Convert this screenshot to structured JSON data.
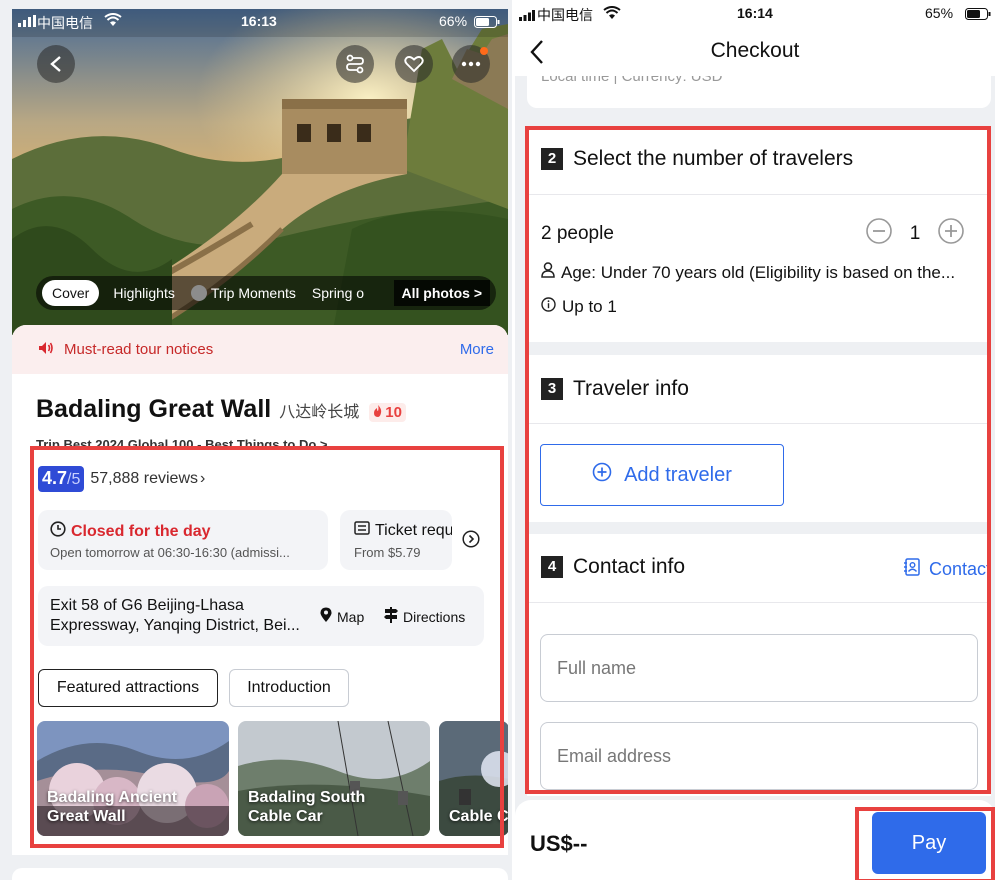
{
  "left": {
    "status": {
      "carrier": "中国电信",
      "time": "16:13",
      "battery": "66%"
    },
    "photo_tabs": [
      "Cover",
      "Highlights",
      "Trip Moments",
      "Spring o"
    ],
    "all_photos": "All photos >",
    "notice": {
      "text": "Must-read tour notices",
      "more": "More"
    },
    "title": {
      "name": "Badaling Great Wall",
      "local": "八达岭长城",
      "hot": "10"
    },
    "award": "Trip.Best 2024 Global 100 - Best Things to Do >",
    "rating": {
      "score": "4.7",
      "max": "/5",
      "reviews": "57,888 reviews"
    },
    "hours": {
      "status": "Closed for the day",
      "detail": "Open tomorrow at 06:30-16:30 (admissi..."
    },
    "ticket": {
      "label": "Ticket requ",
      "price": "From $5.79"
    },
    "address": {
      "line1": "Exit 58 of G6 Beijing-Lhasa",
      "line2": "Expressway, Yanqing District, Bei...",
      "map": "Map",
      "directions": "Directions"
    },
    "chips": [
      "Featured attractions",
      "Introduction"
    ],
    "attractions": [
      "Badaling Ancient\nGreat Wall",
      "Badaling South\nCable Car",
      "Cable C"
    ]
  },
  "right": {
    "status": {
      "carrier": "中国电信",
      "time": "16:14",
      "battery": "65%"
    },
    "header_title": "Checkout",
    "top_cut_text": "Local time | Currency: USD",
    "travelers": {
      "num": "2",
      "title": "Select the number of travelers",
      "people_label": "2 people",
      "count": "1",
      "age": "Age: Under 70 years old (Eligibility is based on the...",
      "limit": "Up to 1"
    },
    "traveler_info": {
      "num": "3",
      "title": "Traveler info",
      "add": "Add traveler"
    },
    "contact_info": {
      "num": "4",
      "title": "Contact info",
      "contact_link": "Contact",
      "full_name": "Full name",
      "email": "Email address"
    },
    "footer": {
      "price": "US$--",
      "pay": "Pay"
    }
  },
  "colors": {
    "brand": "#2f6bea",
    "red_outline": "#e8413f",
    "closed_red": "#d9282f",
    "rating_blue": "#2f4bd6"
  }
}
